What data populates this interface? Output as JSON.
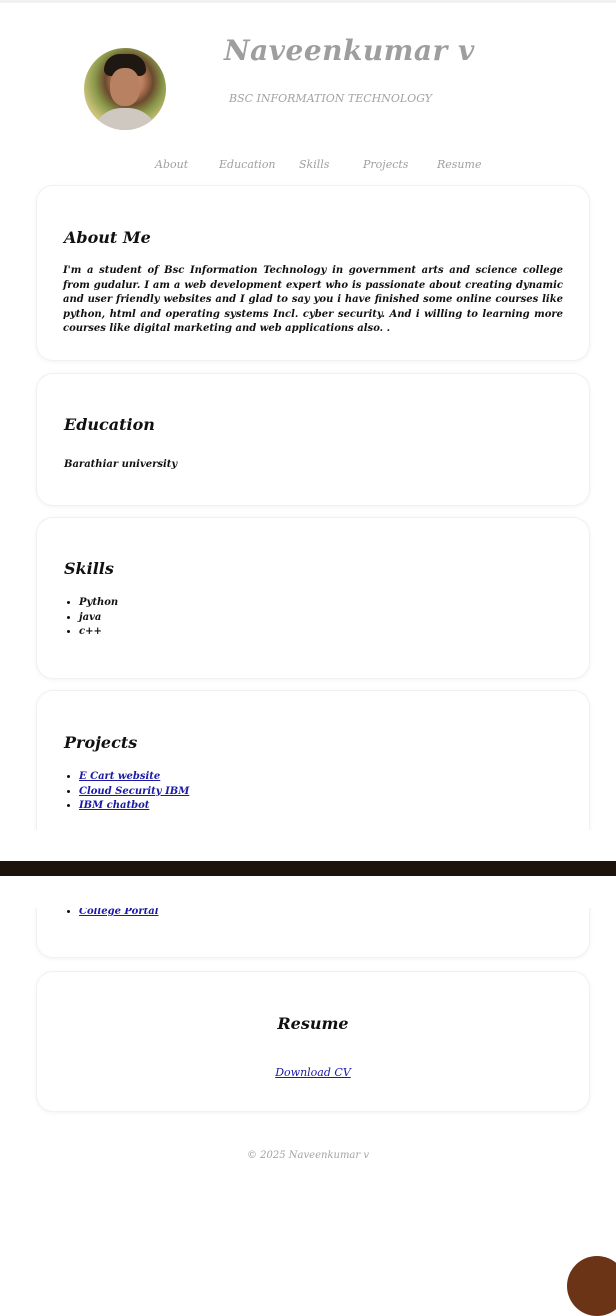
{
  "header": {
    "name": "Naveenkumar v",
    "tagline": "BSC INFORMATION TECHNOLOGY"
  },
  "nav": {
    "items": [
      "About",
      "Education",
      "Skills",
      "Projects",
      "Resume"
    ]
  },
  "about": {
    "title": "About Me",
    "text": "I'm a student of Bsc Information Technology in government arts and science college from gudalur.  I am a web development expert who is passionate about creating dynamic and user friendly websites and I glad to say you i have finished some online courses like python, html and operating systems Incl. cyber security.  And i willing to learning more courses like digital marketing and web applications also.  ."
  },
  "education": {
    "title": "Education",
    "text": "Barathiar university"
  },
  "skills": {
    "title": "Skills",
    "items": [
      "Python",
      "java",
      "c++"
    ]
  },
  "projects": {
    "title": "Projects",
    "items": [
      "E Cart website",
      "Cloud Security IBM",
      "IBM chatbot",
      "College Portal"
    ]
  },
  "resume": {
    "title": "Resume",
    "download_label": "Download CV"
  },
  "footer": {
    "text": "© 2025 Naveenkumar v"
  },
  "colors": {
    "muted_gray": "#9e9e9e",
    "link": "#1a1aa6",
    "dark_bar": "#1c130d",
    "fab": "#6b3417"
  }
}
